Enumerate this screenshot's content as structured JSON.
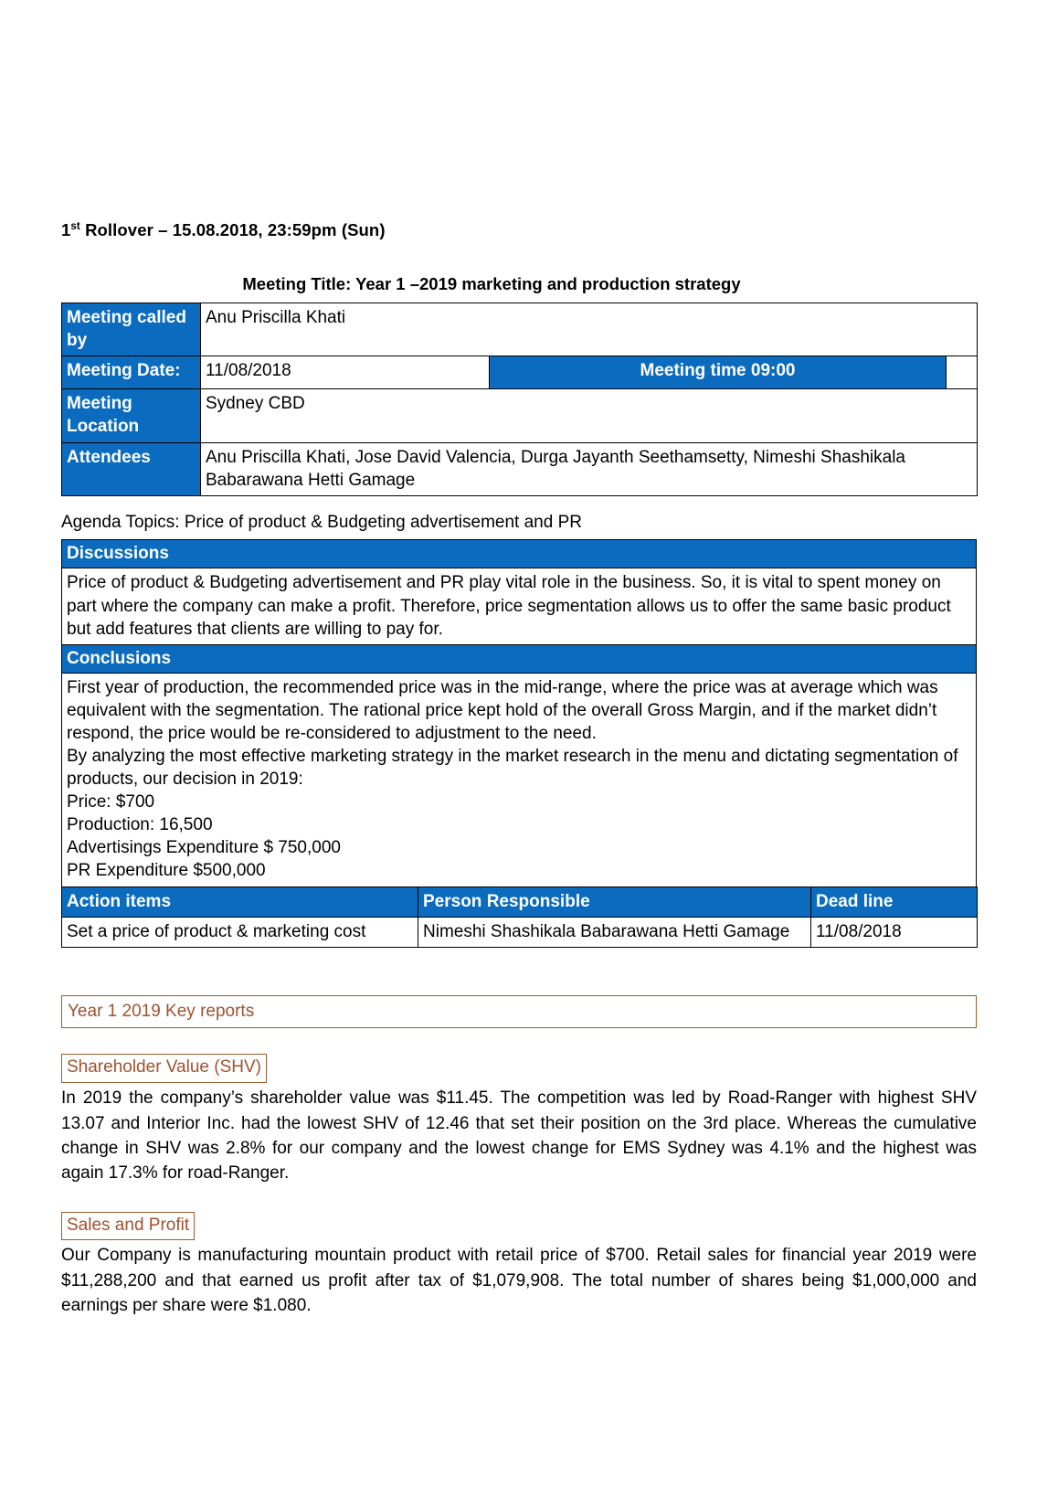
{
  "document": {
    "rollover_heading_prefix": "1",
    "rollover_heading_sup": "st",
    "rollover_heading_rest": " Rollover – 15.08.2018, 23:59pm (Sun)",
    "meeting_title": "Meeting Title: Year 1 –2019 marketing and production strategy"
  },
  "colors": {
    "header_blue": "#0B6BBF",
    "accent_brown": "#A0522D",
    "border_black": "#000000"
  },
  "info_table": {
    "called_by_label": "Meeting called by",
    "called_by_value": "Anu Priscilla Khati",
    "date_label": "Meeting Date:",
    "date_value": "11/08/2018",
    "time_label": "Meeting time 09:00",
    "location_label": "Meeting Location",
    "location_value": "Sydney CBD",
    "attendees_label": "Attendees",
    "attendees_value": "Anu Priscilla Khati, Jose David Valencia,  Durga Jayanth Seethamsetty, Nimeshi Shashikala Babarawana Hetti Gamage"
  },
  "agenda": {
    "line": "Agenda Topics: Price of product & Budgeting advertisement and PR"
  },
  "discussions": {
    "header": "Discussions",
    "body": "Price of product & Budgeting advertisement and PR play vital role in the business. So, it is vital to spent money on part where the company can make a profit. Therefore, price segmentation allows us to offer the same basic product but add features that clients are willing to pay for."
  },
  "conclusions": {
    "header": "Conclusions",
    "para1": " First year of production, the recommended price was in the mid-range, where the price was at average which was equivalent with the segmentation. The rational price kept hold of the overall Gross Margin, and if the market didn’t respond, the price would be re-considered to adjustment to the need.",
    "para2": "By analyzing the most effective marketing strategy in the market research in the menu and dictating segmentation of products, our decision in 2019:",
    "price_line": "Price: $700",
    "production_line": "Production: 16,500",
    "advertising_line": "Advertisings Expenditure $ 750,000",
    "pr_line": "PR Expenditure $500,000"
  },
  "action_table": {
    "headers": [
      "Action items",
      "Person Responsible",
      "Dead line"
    ],
    "rows": [
      [
        "Set a price of product & marketing cost",
        "Nimeshi Shashikala Babarawana Hetti Gamage",
        "11/08/2018"
      ]
    ]
  },
  "key_reports": {
    "box_title": "Year 1 2019 Key reports",
    "shv": {
      "heading": "Shareholder Value (SHV)",
      "paragraph": "In 2019 the company’s shareholder value was $11.45. The competition was led by Road-Ranger with highest SHV 13.07 and Interior Inc. had the lowest SHV of 12.46 that set their position on the 3rd place. Whereas the cumulative change in SHV was 2.8% for our company and the lowest change for EMS Sydney was 4.1% and the highest was again 17.3% for road-Ranger."
    },
    "sales_profit": {
      "heading": "Sales and Profit",
      "paragraph": "Our Company is manufacturing mountain product with retail price of $700. Retail sales for financial year 2019 were $11,288,200 and that earned us profit after tax of $1,079,908. The total number of shares being $1,000,000 and earnings per share were $1.080."
    }
  }
}
